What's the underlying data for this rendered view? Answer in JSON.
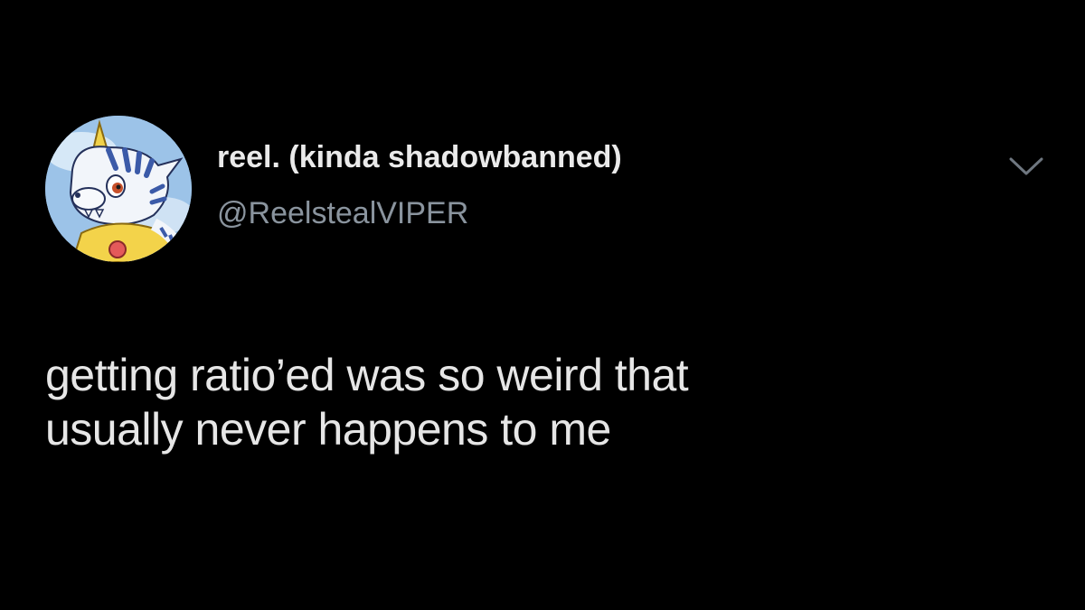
{
  "tweet": {
    "display_name": "reel. (kinda shadowbanned)",
    "handle": "@ReelstealVIPER",
    "text_lines": [
      "getting ratio’ed was so weird that",
      "usually never happens to me"
    ],
    "avatar_icon": "avatar-gabumon",
    "caret_icon": "chevron-down-icon"
  },
  "colors": {
    "background": "#000000",
    "name": "#eaeaea",
    "handle": "#8a949e",
    "text": "#e6e6e6"
  }
}
